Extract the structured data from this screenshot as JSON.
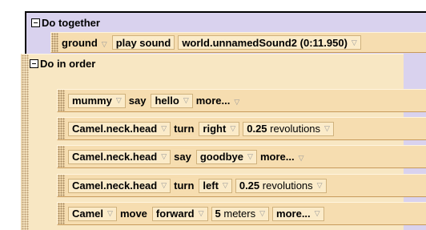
{
  "do_together": {
    "label": "Do together"
  },
  "sound_stmt": {
    "object": "ground",
    "method": "play sound",
    "sound": "world.unnamedSound2 (0:11.950)"
  },
  "do_in_order": {
    "label": "Do in order"
  },
  "stmt1": {
    "object": "mummy",
    "method": "say",
    "text": "hello",
    "more": "more..."
  },
  "stmt2": {
    "object": "Camel.neck.head",
    "method": "turn",
    "direction": "right",
    "amount": "0.25",
    "unit": "revolutions"
  },
  "stmt3": {
    "object": "Camel.neck.head",
    "method": "say",
    "text": "goodbye",
    "more": "more..."
  },
  "stmt4": {
    "object": "Camel.neck.head",
    "method": "turn",
    "direction": "left",
    "amount": "0.25",
    "unit": "revolutions"
  },
  "stmt5": {
    "object": "Camel",
    "method": "move",
    "direction": "forward",
    "amount": "5",
    "unit": "meters",
    "more": "more..."
  },
  "icons": {
    "dropdown": "▽"
  }
}
